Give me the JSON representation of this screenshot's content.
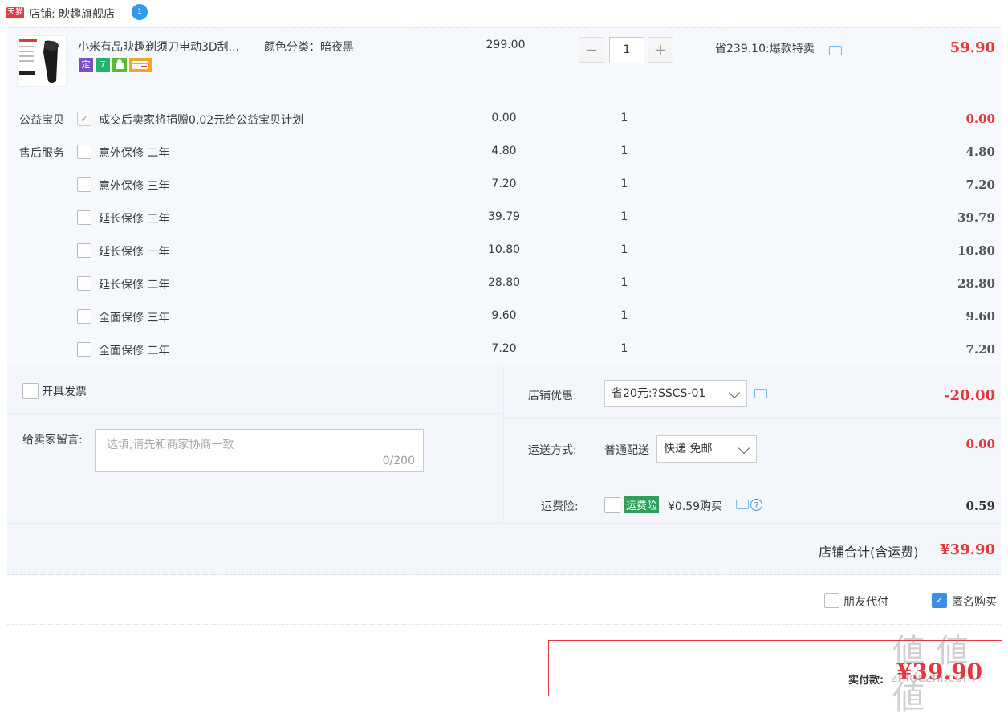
{
  "shop": {
    "badge": "天猫",
    "name": "店铺: 映趣旗舰店",
    "wangwang": "1"
  },
  "product": {
    "title": "小米有品映趣剃须刀电动3D刮...",
    "sku": "颜色分类：暗夜黑",
    "price": "299.00",
    "qty": "1",
    "discount": "省239.10:爆款特卖",
    "total": "59.90",
    "badges": [
      "定",
      "7",
      "",
      ""
    ]
  },
  "charity": {
    "label": "公益宝贝",
    "text": "成交后卖家将捐赠0.02元给公益宝贝计划",
    "price": "0.00",
    "qty": "1",
    "total": "0.00"
  },
  "service": {
    "label": "售后服务",
    "options": [
      {
        "name": "意外保修 二年",
        "price": "4.80",
        "qty": "1",
        "total": "4.80"
      },
      {
        "name": "意外保修 三年",
        "price": "7.20",
        "qty": "1",
        "total": "7.20"
      },
      {
        "name": "延长保修 三年",
        "price": "39.79",
        "qty": "1",
        "total": "39.79"
      },
      {
        "name": "延长保修 一年",
        "price": "10.80",
        "qty": "1",
        "total": "10.80"
      },
      {
        "name": "延长保修 二年",
        "price": "28.80",
        "qty": "1",
        "total": "28.80"
      },
      {
        "name": "全面保修 三年",
        "price": "9.60",
        "qty": "1",
        "total": "9.60"
      },
      {
        "name": "全面保修 二年",
        "price": "7.20",
        "qty": "1",
        "total": "7.20"
      }
    ]
  },
  "invoice": {
    "label": "开具发票"
  },
  "message": {
    "label": "给卖家留言:",
    "placeholder": "选填,请先和商家协商一致",
    "counter": "0/200"
  },
  "coupon": {
    "label": "店铺优惠:",
    "value": "省20元:?SSCS-01",
    "amount": "-20.00"
  },
  "shipping": {
    "label": "运送方式:",
    "method": "普通配送",
    "value": "快递 免邮",
    "amount": "0.00"
  },
  "insurance": {
    "label": "运费险:",
    "badge": "运费险",
    "text": "¥0.59购买",
    "amount": "0.59"
  },
  "subtotal": {
    "label": "店铺合计(含运费)",
    "amount": "¥39.90"
  },
  "options": {
    "friend_pay": "朋友代付",
    "anonymous": "匿名购买"
  },
  "payment": {
    "label": "实付款:",
    "amount": "¥39.90"
  },
  "watermark": {
    "main": "値 値 値",
    "sub": "zhidezhi.com"
  }
}
